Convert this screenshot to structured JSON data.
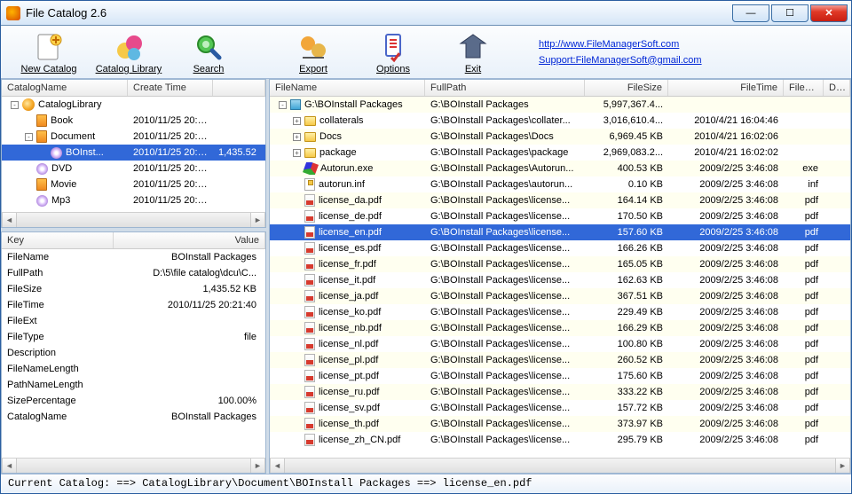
{
  "window": {
    "title": "File Catalog  2.6"
  },
  "toolbar": {
    "newCatalog": "New Catalog",
    "catalogLibrary": "Catalog Library",
    "search": "Search",
    "export": "Export",
    "options": "Options",
    "exit": "Exit"
  },
  "links": {
    "site": "http://www.FileManagerSoft.com",
    "support": "Support:FileManagerSoft@gmail.com"
  },
  "treeCols": {
    "name": "CatalogName",
    "time": "Create Time"
  },
  "tree": [
    {
      "depth": 0,
      "expander": "-",
      "icon": "lib",
      "name": "CatalogLibrary",
      "time": "",
      "sel": false
    },
    {
      "depth": 1,
      "expander": "",
      "icon": "book",
      "name": "Book",
      "time": "2010/11/25 20:2...",
      "sel": false
    },
    {
      "depth": 1,
      "expander": "-",
      "icon": "book",
      "name": "Document",
      "time": "2010/11/25 20:2...",
      "sel": false
    },
    {
      "depth": 2,
      "expander": "",
      "icon": "disc",
      "name": "BOInst...",
      "time": "2010/11/25 20:2...",
      "extra": "1,435.52",
      "sel": true
    },
    {
      "depth": 1,
      "expander": "",
      "icon": "disc",
      "name": "DVD",
      "time": "2010/11/25 20:2...",
      "sel": false
    },
    {
      "depth": 1,
      "expander": "",
      "icon": "book",
      "name": "Movie",
      "time": "2010/11/25 20:2...",
      "sel": false
    },
    {
      "depth": 1,
      "expander": "",
      "icon": "disc",
      "name": "Mp3",
      "time": "2010/11/25 20:2...",
      "sel": false
    }
  ],
  "propCols": {
    "k": "Key",
    "v": "Value"
  },
  "props": [
    {
      "k": "FileName",
      "v": "BOInstall Packages"
    },
    {
      "k": "FullPath",
      "v": "D:\\5\\file catalog\\dcu\\C..."
    },
    {
      "k": "FileSize",
      "v": "1,435.52 KB"
    },
    {
      "k": "FileTime",
      "v": "2010/11/25 20:21:40"
    },
    {
      "k": "FileExt",
      "v": ""
    },
    {
      "k": "FileType",
      "v": "file"
    },
    {
      "k": "Description",
      "v": ""
    },
    {
      "k": "FileNameLength",
      "v": ""
    },
    {
      "k": "PathNameLength",
      "v": ""
    },
    {
      "k": "SizePercentage",
      "v": "100.00%"
    },
    {
      "k": "CatalogName",
      "v": "BOInstall Packages"
    }
  ],
  "rightCols": {
    "fn": "FileName",
    "fp": "FullPath",
    "fs": "FileSize",
    "ft": "FileTime",
    "fe": "FileExt",
    "de": "Descrip"
  },
  "files": [
    {
      "depth": 0,
      "exp": "-",
      "icon": "box",
      "name": "G:\\BOInstall Packages",
      "fp": "G:\\BOInstall Packages",
      "fs": "5,997,367.4...",
      "ft": "",
      "fe": "",
      "sel": false
    },
    {
      "depth": 1,
      "exp": "+",
      "icon": "folder",
      "name": "collaterals",
      "fp": "G:\\BOInstall Packages\\collater...",
      "fs": "3,016,610.4...",
      "ft": "2010/4/21 16:04:46",
      "fe": "",
      "sel": false
    },
    {
      "depth": 1,
      "exp": "+",
      "icon": "folder",
      "name": "Docs",
      "fp": "G:\\BOInstall Packages\\Docs",
      "fs": "6,969.45 KB",
      "ft": "2010/4/21 16:02:06",
      "fe": "",
      "sel": false
    },
    {
      "depth": 1,
      "exp": "+",
      "icon": "folder",
      "name": "package",
      "fp": "G:\\BOInstall Packages\\package",
      "fs": "2,969,083.2...",
      "ft": "2010/4/21 16:02:02",
      "fe": "",
      "sel": false
    },
    {
      "depth": 1,
      "exp": "",
      "icon": "exe",
      "name": "Autorun.exe",
      "fp": "G:\\BOInstall Packages\\Autorun...",
      "fs": "400.53 KB",
      "ft": "2009/2/25 3:46:08",
      "fe": "exe",
      "sel": false
    },
    {
      "depth": 1,
      "exp": "",
      "icon": "inf",
      "name": "autorun.inf",
      "fp": "G:\\BOInstall Packages\\autorun...",
      "fs": "0.10 KB",
      "ft": "2009/2/25 3:46:08",
      "fe": "inf",
      "sel": false
    },
    {
      "depth": 1,
      "exp": "",
      "icon": "pdf",
      "name": "license_da.pdf",
      "fp": "G:\\BOInstall Packages\\license...",
      "fs": "164.14 KB",
      "ft": "2009/2/25 3:46:08",
      "fe": "pdf",
      "sel": false
    },
    {
      "depth": 1,
      "exp": "",
      "icon": "pdf",
      "name": "license_de.pdf",
      "fp": "G:\\BOInstall Packages\\license...",
      "fs": "170.50 KB",
      "ft": "2009/2/25 3:46:08",
      "fe": "pdf",
      "sel": false
    },
    {
      "depth": 1,
      "exp": "",
      "icon": "pdf",
      "name": "license_en.pdf",
      "fp": "G:\\BOInstall Packages\\license...",
      "fs": "157.60 KB",
      "ft": "2009/2/25 3:46:08",
      "fe": "pdf",
      "sel": true
    },
    {
      "depth": 1,
      "exp": "",
      "icon": "pdf",
      "name": "license_es.pdf",
      "fp": "G:\\BOInstall Packages\\license...",
      "fs": "166.26 KB",
      "ft": "2009/2/25 3:46:08",
      "fe": "pdf",
      "sel": false
    },
    {
      "depth": 1,
      "exp": "",
      "icon": "pdf",
      "name": "license_fr.pdf",
      "fp": "G:\\BOInstall Packages\\license...",
      "fs": "165.05 KB",
      "ft": "2009/2/25 3:46:08",
      "fe": "pdf",
      "sel": false
    },
    {
      "depth": 1,
      "exp": "",
      "icon": "pdf",
      "name": "license_it.pdf",
      "fp": "G:\\BOInstall Packages\\license...",
      "fs": "162.63 KB",
      "ft": "2009/2/25 3:46:08",
      "fe": "pdf",
      "sel": false
    },
    {
      "depth": 1,
      "exp": "",
      "icon": "pdf",
      "name": "license_ja.pdf",
      "fp": "G:\\BOInstall Packages\\license...",
      "fs": "367.51 KB",
      "ft": "2009/2/25 3:46:08",
      "fe": "pdf",
      "sel": false
    },
    {
      "depth": 1,
      "exp": "",
      "icon": "pdf",
      "name": "license_ko.pdf",
      "fp": "G:\\BOInstall Packages\\license...",
      "fs": "229.49 KB",
      "ft": "2009/2/25 3:46:08",
      "fe": "pdf",
      "sel": false
    },
    {
      "depth": 1,
      "exp": "",
      "icon": "pdf",
      "name": "license_nb.pdf",
      "fp": "G:\\BOInstall Packages\\license...",
      "fs": "166.29 KB",
      "ft": "2009/2/25 3:46:08",
      "fe": "pdf",
      "sel": false
    },
    {
      "depth": 1,
      "exp": "",
      "icon": "pdf",
      "name": "license_nl.pdf",
      "fp": "G:\\BOInstall Packages\\license...",
      "fs": "100.80 KB",
      "ft": "2009/2/25 3:46:08",
      "fe": "pdf",
      "sel": false
    },
    {
      "depth": 1,
      "exp": "",
      "icon": "pdf",
      "name": "license_pl.pdf",
      "fp": "G:\\BOInstall Packages\\license...",
      "fs": "260.52 KB",
      "ft": "2009/2/25 3:46:08",
      "fe": "pdf",
      "sel": false
    },
    {
      "depth": 1,
      "exp": "",
      "icon": "pdf",
      "name": "license_pt.pdf",
      "fp": "G:\\BOInstall Packages\\license...",
      "fs": "175.60 KB",
      "ft": "2009/2/25 3:46:08",
      "fe": "pdf",
      "sel": false
    },
    {
      "depth": 1,
      "exp": "",
      "icon": "pdf",
      "name": "license_ru.pdf",
      "fp": "G:\\BOInstall Packages\\license...",
      "fs": "333.22 KB",
      "ft": "2009/2/25 3:46:08",
      "fe": "pdf",
      "sel": false
    },
    {
      "depth": 1,
      "exp": "",
      "icon": "pdf",
      "name": "license_sv.pdf",
      "fp": "G:\\BOInstall Packages\\license...",
      "fs": "157.72 KB",
      "ft": "2009/2/25 3:46:08",
      "fe": "pdf",
      "sel": false
    },
    {
      "depth": 1,
      "exp": "",
      "icon": "pdf",
      "name": "license_th.pdf",
      "fp": "G:\\BOInstall Packages\\license...",
      "fs": "373.97 KB",
      "ft": "2009/2/25 3:46:08",
      "fe": "pdf",
      "sel": false
    },
    {
      "depth": 1,
      "exp": "",
      "icon": "pdf",
      "name": "license_zh_CN.pdf",
      "fp": "G:\\BOInstall Packages\\license...",
      "fs": "295.79 KB",
      "ft": "2009/2/25 3:46:08",
      "fe": "pdf",
      "sel": false
    }
  ],
  "status": "Current Catalog: ==> CatalogLibrary\\Document\\BOInstall Packages ==> license_en.pdf"
}
